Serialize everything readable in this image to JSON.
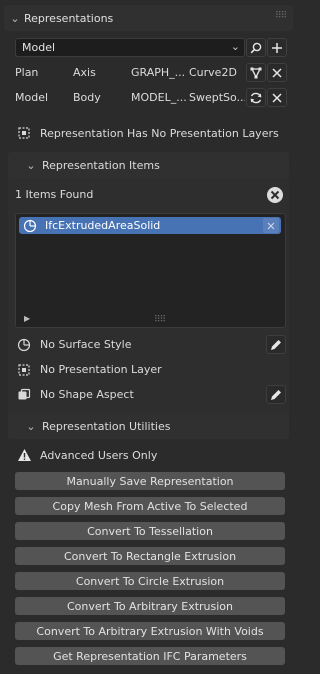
{
  "panel": {
    "title": "Representations"
  },
  "context": {
    "selected": "Model"
  },
  "representations": [
    {
      "context": "Plan",
      "subcontext": "Axis",
      "target_view": "GRAPH_...",
      "type": "Curve2D"
    },
    {
      "context": "Model",
      "subcontext": "Body",
      "target_view": "MODEL_...",
      "type": "SweptSo..."
    }
  ],
  "presentation_layers_message": "Representation Has No Presentation Layers",
  "items_section": {
    "title": "Representation Items",
    "count_text": "1 Items Found",
    "items": [
      {
        "label": "IfcExtrudedAreaSolid"
      }
    ]
  },
  "properties": {
    "surface_style": "No Surface Style",
    "presentation_layer": "No Presentation Layer",
    "shape_aspect": "No Shape Aspect"
  },
  "utilities": {
    "title": "Representation Utilities",
    "warning": "Advanced Users Only",
    "buttons": [
      "Manually Save Representation",
      "Copy Mesh From Active To Selected",
      "Convert To Tessellation",
      "Convert To Rectangle Extrusion",
      "Convert To Circle Extrusion",
      "Convert To Arbitrary Extrusion",
      "Convert To Arbitrary Extrusion With Voids",
      "Get Representation IFC Parameters"
    ]
  },
  "colors": {
    "selection": "#4772b3",
    "button": "#545454",
    "panel": "#303030",
    "background": "#2b2b2b"
  }
}
